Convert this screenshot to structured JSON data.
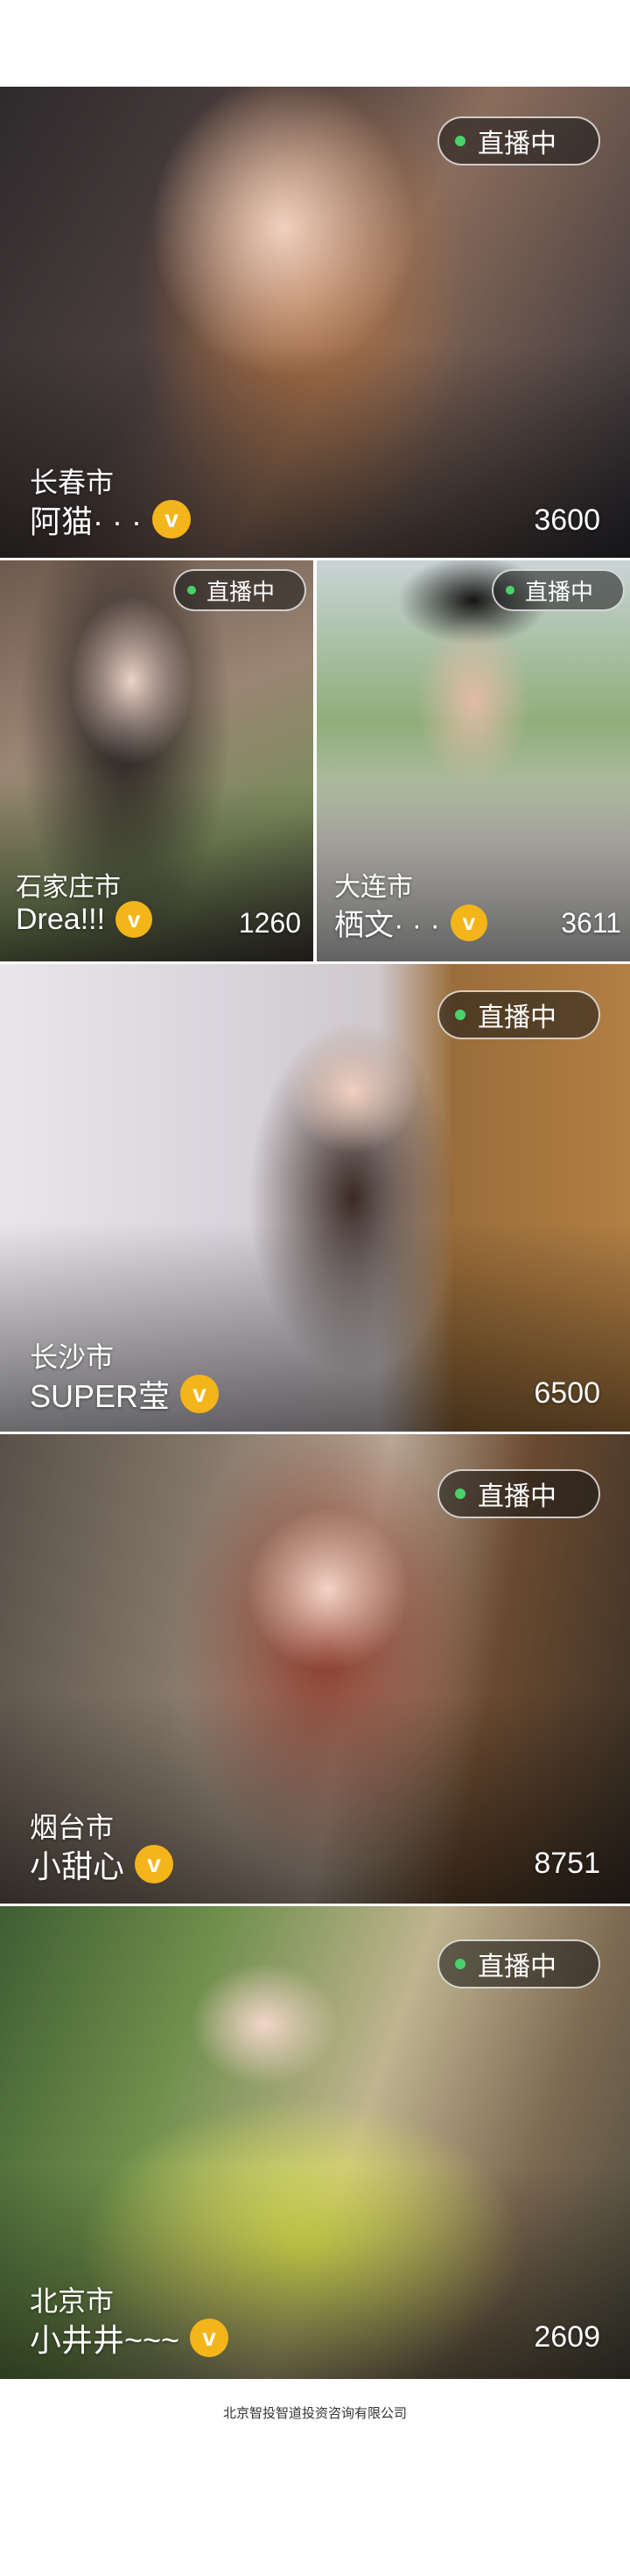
{
  "live_label": "直播中",
  "streams": [
    {
      "city": "长春市",
      "name": "阿猫· · ·",
      "vip": "v",
      "count": "3600"
    },
    {
      "city": "石家庄市",
      "name": "Drea!!!",
      "vip": "v",
      "count": "1260"
    },
    {
      "city": "大连市",
      "name": "栖文· · ·",
      "vip": "v",
      "count": "3611"
    },
    {
      "city": "长沙市",
      "name": "SUPER莹",
      "vip": "v",
      "count": "6500"
    },
    {
      "city": "烟台市",
      "name": "小甜心",
      "vip": "v",
      "count": "8751"
    },
    {
      "city": "北京市",
      "name": "小井井~~~",
      "vip": "v",
      "count": "2609"
    }
  ],
  "footer": "北京智投智道投资咨询有限公司",
  "colors": {
    "live_dot": "#49d26a",
    "vip_badge": "#f3b519"
  }
}
